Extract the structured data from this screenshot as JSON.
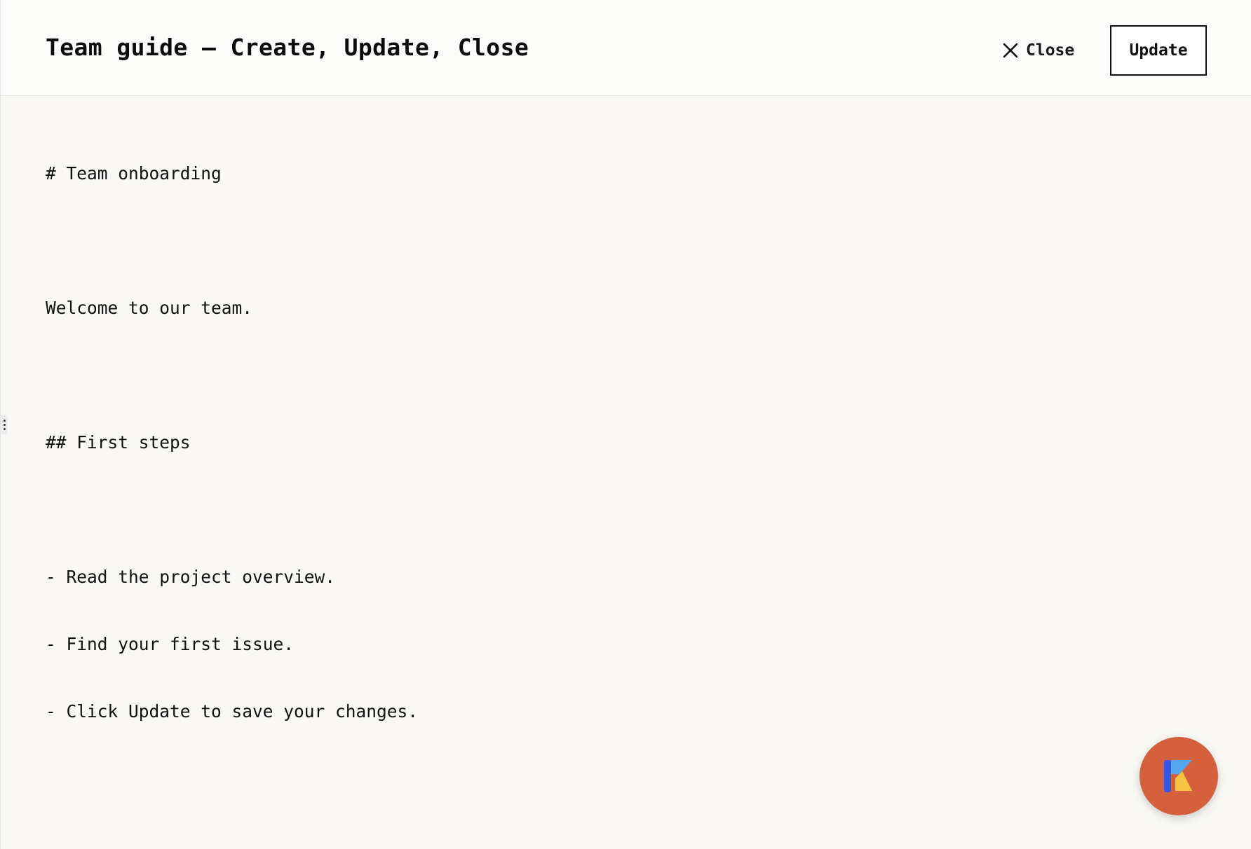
{
  "header": {
    "title": "Team guide — Create, Update, Close",
    "close_label": "Close",
    "update_label": "Update"
  },
  "editor": {
    "lines": [
      "# Team onboarding",
      "",
      "Welcome to our team.",
      "",
      "## First steps",
      "",
      "- Read the project overview.",
      "- Find your first issue.",
      "- Click Update to save your changes."
    ]
  },
  "icons": {
    "close": "close-icon",
    "resize": "drag-handle-icon",
    "fab": "kotlin-logo-icon"
  },
  "colors": {
    "background": "#f9f8f5",
    "header_background": "#fbfbf9",
    "fab_background": "#d4603e",
    "text": "#111111"
  }
}
